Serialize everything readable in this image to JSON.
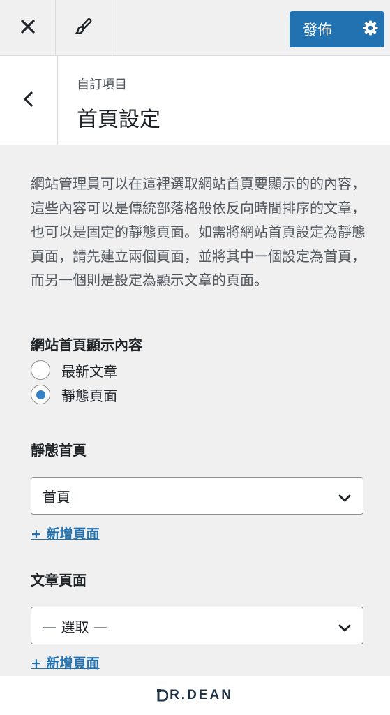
{
  "topbar": {
    "close_icon": "close-icon",
    "brush_icon": "paintbrush-icon",
    "publish_label": "發佈",
    "settings_icon": "gear-icon",
    "accent": "#2271b1"
  },
  "header": {
    "breadcrumb": "自訂項目",
    "title": "首頁設定"
  },
  "description": "網站管理員可以在這裡選取網站首頁要顯示的的內容，這些內容可以是傳統部落格般依反向時間排序的文章，也可以是固定的靜態頁面。如需將網站首頁設定為靜態頁面，請先建立兩個頁面，並將其中一個設定為首頁，而另一個則是設定為顯示文章的頁面。",
  "homepage_display": {
    "label": "網站首頁顯示內容",
    "options": [
      {
        "label": "最新文章",
        "selected": false
      },
      {
        "label": "靜態頁面",
        "selected": true
      }
    ]
  },
  "static_front": {
    "label": "靜態首頁",
    "selected": "首頁",
    "add_link": "+ 新增頁面"
  },
  "posts_page": {
    "label": "文章頁面",
    "selected": "— 選取 —",
    "add_link": "+ 新增頁面"
  },
  "footer": {
    "logo_first": "R",
    "logo_rest": ".DEAN"
  }
}
